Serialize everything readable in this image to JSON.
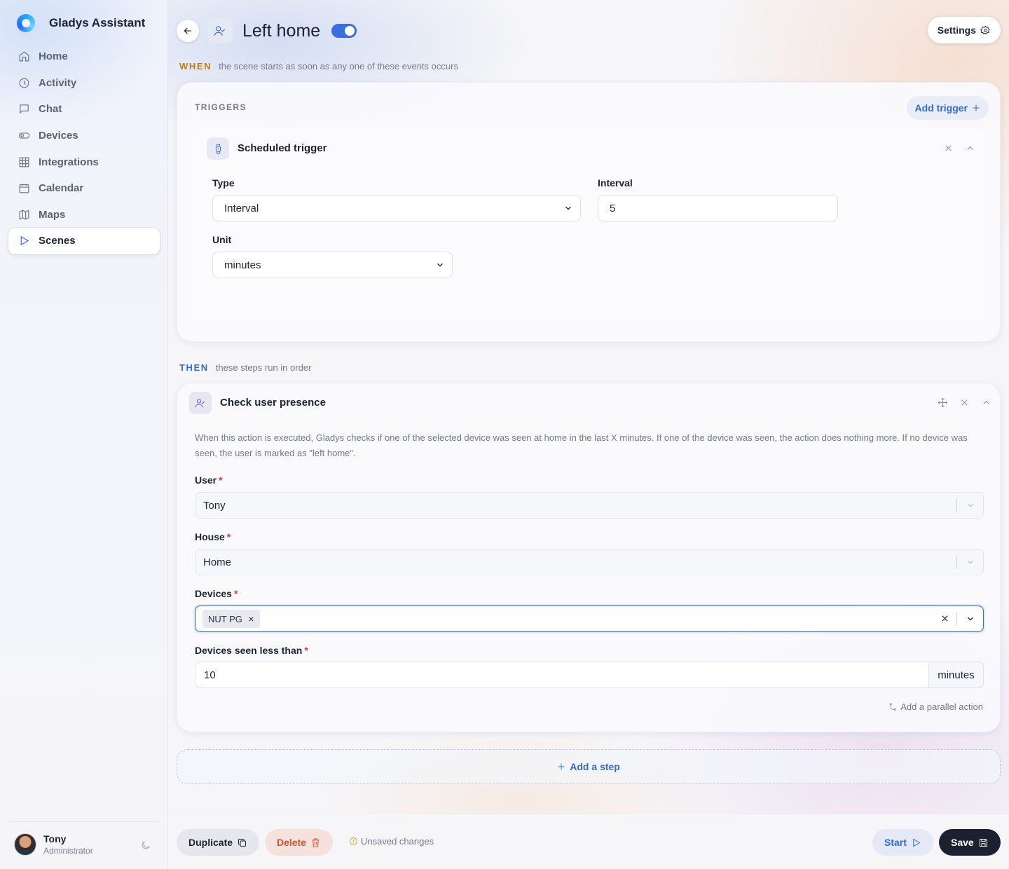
{
  "app": {
    "name": "Gladys Assistant"
  },
  "nav": {
    "items": [
      {
        "label": "Home",
        "icon": "home-icon"
      },
      {
        "label": "Activity",
        "icon": "clock-icon"
      },
      {
        "label": "Chat",
        "icon": "chat-icon"
      },
      {
        "label": "Devices",
        "icon": "toggle-icon"
      },
      {
        "label": "Integrations",
        "icon": "grid-icon"
      },
      {
        "label": "Calendar",
        "icon": "calendar-icon"
      },
      {
        "label": "Maps",
        "icon": "map-icon"
      },
      {
        "label": "Scenes",
        "icon": "play-icon",
        "active": true
      }
    ]
  },
  "user": {
    "name": "Tony",
    "role": "Administrator"
  },
  "scene": {
    "title": "Left home",
    "enabled": true
  },
  "header": {
    "settings_label": "Settings"
  },
  "when": {
    "keyword": "WHEN",
    "text": "the scene starts as soon as any one of these events occurs"
  },
  "triggers": {
    "heading": "TRIGGERS",
    "add_label": "Add trigger",
    "items": [
      {
        "title": "Scheduled trigger",
        "type_label": "Type",
        "type_value": "Interval",
        "interval_label": "Interval",
        "interval_value": "5",
        "unit_label": "Unit",
        "unit_value": "minutes"
      }
    ]
  },
  "then": {
    "keyword": "THEN",
    "text": "these steps run in order"
  },
  "action": {
    "title": "Check user presence",
    "description": "When this action is executed, Gladys checks if one of the selected device was seen at home in the last X minutes. If one of the device was seen, the action does nothing more. If no device was seen, the user is marked as \"left home\".",
    "user_label": "User",
    "user_value": "Tony",
    "house_label": "House",
    "house_value": "Home",
    "devices_label": "Devices",
    "devices_tags": [
      "NUT PG"
    ],
    "seen_label": "Devices seen less than",
    "seen_value": "10",
    "seen_unit": "minutes",
    "parallel_label": "Add a parallel action"
  },
  "add_step_label": "Add a step",
  "footer": {
    "duplicate_label": "Duplicate",
    "delete_label": "Delete",
    "unsaved_label": "Unsaved changes",
    "start_label": "Start",
    "save_label": "Save"
  },
  "colors": {
    "accent": "#2f6be0",
    "when": "#c47a12",
    "danger": "#d1532f",
    "save_bg": "#1b2130"
  }
}
